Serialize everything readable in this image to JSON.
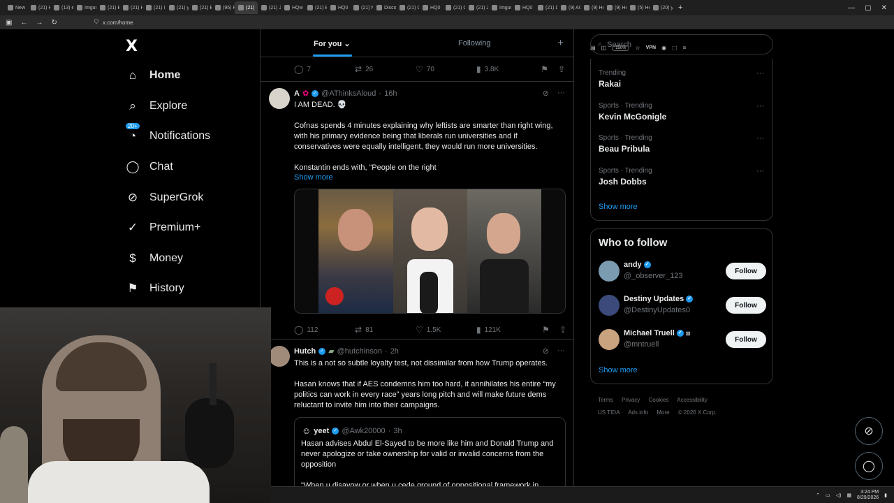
{
  "browser": {
    "tabs": [
      "New",
      "(21) H",
      "(13) e",
      "Imgur",
      "(21) E",
      "(21) H",
      "(21) I",
      "(21) y",
      "(21) E",
      "(95) R",
      "(21)",
      "(21) J",
      "HQw",
      "(21) E",
      "HQ0",
      "(21) N",
      "Disco",
      "(21) C",
      "HQ0",
      "(21) C",
      "(21) J",
      "Imgur",
      "HQ0",
      "(21) D",
      "(9) AC",
      "(9) He",
      "(9) He",
      "(5) He",
      "(20) y"
    ],
    "active_tab_index": 10,
    "url": "x.com/home",
    "zoom": "150%",
    "vpn": "VPN"
  },
  "nav": {
    "logo": "X",
    "items": [
      {
        "label": "Home",
        "icon": "home-icon"
      },
      {
        "label": "Explore",
        "icon": "search-icon"
      },
      {
        "label": "Notifications",
        "icon": "bell-icon",
        "badge": "20+"
      },
      {
        "label": "Chat",
        "icon": "chat-icon"
      },
      {
        "label": "SuperGrok",
        "icon": "grok-icon"
      },
      {
        "label": "Premium+",
        "icon": "verified-icon"
      },
      {
        "label": "Money",
        "icon": "dollar-icon"
      },
      {
        "label": "History",
        "icon": "bookmark-icon"
      }
    ]
  },
  "feed": {
    "tabs": {
      "for_you": "For you",
      "following": "Following",
      "plus": "+"
    },
    "prev_actions": {
      "replies": "7",
      "reposts": "26",
      "likes": "70",
      "views": "3.8K"
    },
    "post1": {
      "name": "A",
      "handle": "@AThinksAloud",
      "time": "16h",
      "line1": "I AM DEAD. 💀",
      "para1": "Cofnas spends 4 minutes explaining why leftists are smarter than right wing, with his primary evidence being that liberals run universities and if conservatives were equally intelligent, they would run more universities.",
      "para2": "Konstantin ends with, “People on the right",
      "show_more": "Show more",
      "actions": {
        "replies": "112",
        "reposts": "81",
        "likes": "1.5K",
        "views": "121K"
      }
    },
    "post2": {
      "name": "Hutch",
      "handle": "@hutchinson",
      "time": "2h",
      "line1": "This is a not so subtle loyalty test, not dissimilar from how Trump operates.",
      "para1": "Hasan knows that if AES condemns him too hard, it annihilates his entire “my politics can work in every race” years long pitch and will make future dems reluctant to invite him into their campaigns.",
      "quote": {
        "name": "yeet",
        "handle": "@Awk20000",
        "time": "3h",
        "text": "Hasan advises Abdul El-Sayed to be more like him and Donald Trump and never apologize or take ownership for valid or invalid concerns from the opposition",
        "text2": "\"When u disavow or when u cede ground of oppositional framework in"
      }
    }
  },
  "sidebar": {
    "search_placeholder": "Search",
    "trends": [
      {
        "category": "Trending",
        "topic": "Rakai"
      },
      {
        "category": "Sports · Trending",
        "topic": "Kevin McGonigle"
      },
      {
        "category": "Sports · Trending",
        "topic": "Beau Pribula"
      },
      {
        "category": "Sports · Trending",
        "topic": "Josh Dobbs"
      }
    ],
    "show_more": "Show more",
    "who_to_follow": {
      "title": "Who to follow",
      "users": [
        {
          "name": "andy",
          "handle": "@_observer_123",
          "button": "Follow"
        },
        {
          "name": "Destiny Updates",
          "handle": "@DestinyUpdates0",
          "button": "Follow"
        },
        {
          "name": "Michael Truell",
          "handle": "@mntruell",
          "button": "Follow"
        }
      ],
      "show_more": "Show more"
    },
    "footer": [
      "Terms",
      "Privacy",
      "Cookies",
      "Accessibility",
      "US TIDA",
      "Ads info",
      "More",
      "© 2026 X Corp."
    ]
  },
  "taskbar": {
    "time": "3:24 PM",
    "date": "8/29/2026"
  }
}
